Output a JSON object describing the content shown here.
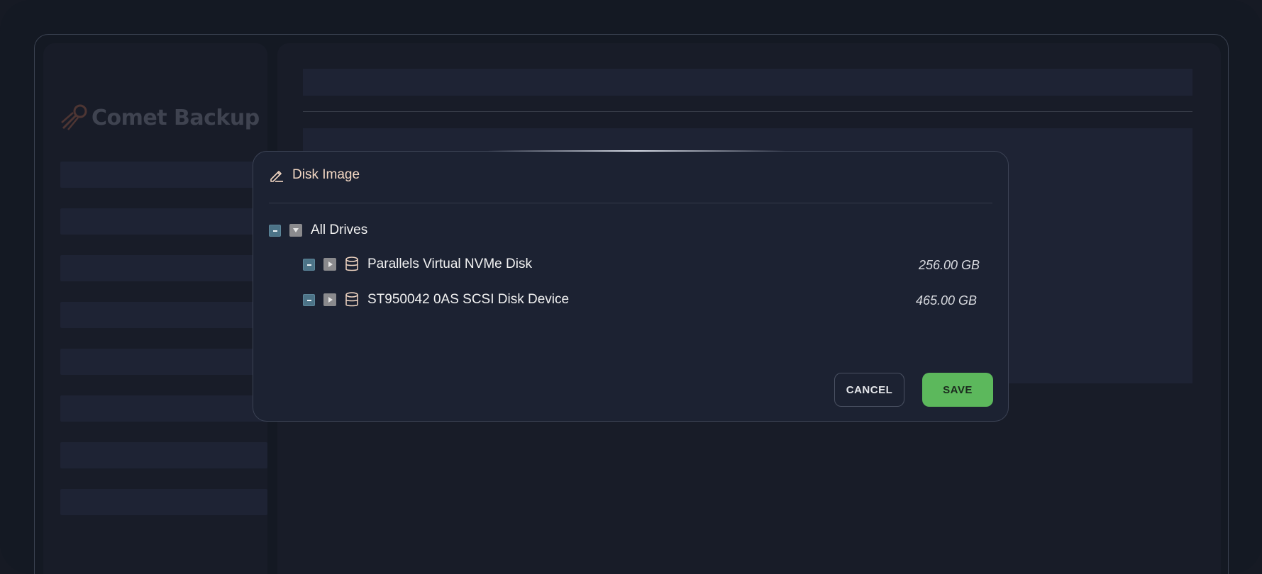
{
  "app": {
    "logo_text": "Comet Backup"
  },
  "sidebar": {
    "items": [
      {
        "label": ""
      },
      {
        "label": ""
      },
      {
        "label": ""
      },
      {
        "label": ""
      },
      {
        "label": ""
      },
      {
        "label": ""
      },
      {
        "label": ""
      },
      {
        "label": ""
      }
    ]
  },
  "modal": {
    "title": "Disk Image",
    "title_icon": "pencil-icon",
    "tree": {
      "root": {
        "label": "All Drives",
        "checked": "partial",
        "expanded": true
      },
      "drives": [
        {
          "label": "Parallels Virtual NVMe Disk",
          "size": "256.00 GB",
          "checked": "partial",
          "expanded": false,
          "icon": "database-icon"
        },
        {
          "label": "ST950042 0AS SCSI Disk Device",
          "size": "465.00 GB",
          "checked": "partial",
          "expanded": false,
          "icon": "database-icon"
        }
      ]
    },
    "buttons": {
      "cancel_label": "CANCEL",
      "save_label": "SAVE"
    }
  },
  "colors": {
    "background": "#141923",
    "panel": "#181c28",
    "modal": "#1c2232",
    "title_accent": "#f3d8c4",
    "checkbox": "#4c7387",
    "save_button": "#5cb85c"
  }
}
